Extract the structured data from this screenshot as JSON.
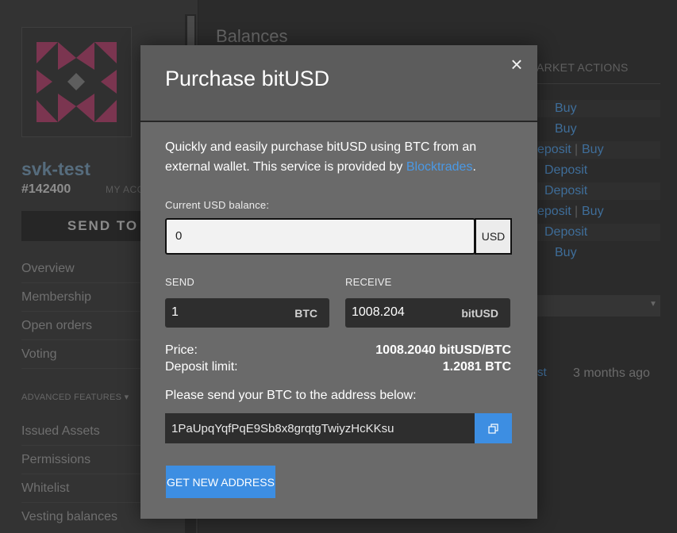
{
  "sidebar": {
    "account_name": "svk-test",
    "account_id": "#142400",
    "my_account_label": "MY ACC",
    "send_to_label": "SEND TO",
    "nav": [
      "Overview",
      "Membership",
      "Open orders",
      "Voting"
    ],
    "advanced_label": "ADVANCED FEATURES ▾",
    "advanced_nav": [
      "Issued Assets",
      "Permissions",
      "Whitelist",
      "Vesting balances"
    ]
  },
  "main": {
    "title": "Balances",
    "market_actions_header": "ARKET ACTIONS",
    "action_rows": [
      {
        "left": "",
        "right": "Buy"
      },
      {
        "left": "",
        "right": "Buy"
      },
      {
        "left": "eposit",
        "right": "Buy"
      },
      {
        "left": "",
        "right": "Deposit"
      },
      {
        "left": "",
        "right": "Deposit"
      },
      {
        "left": "eposit",
        "right": "Buy"
      },
      {
        "left": "",
        "right": "Deposit"
      },
      {
        "left": "",
        "right": "Buy"
      }
    ],
    "history_link": "st",
    "history_time": "3 months ago"
  },
  "modal": {
    "title": "Purchase bitUSD",
    "close_glyph": "×",
    "intro_text": "Quickly and easily purchase bitUSD using BTC from an external wallet. This service is provided by ",
    "intro_link": "Blocktrades",
    "intro_end": ".",
    "balance_label": "Current USD balance:",
    "balance_value": "0",
    "balance_unit": "USD",
    "send_label": "SEND",
    "send_value": "1",
    "send_currency": "BTC",
    "receive_label": "RECEIVE",
    "receive_value": "1008.204",
    "receive_currency": "bitUSD",
    "price_label": "Price:",
    "price_value": "1008.2040 bitUSD/BTC",
    "deposit_limit_label": "Deposit limit:",
    "deposit_limit_value": "1.2081 BTC",
    "address_prompt": "Please send your BTC to the address below:",
    "address": "1PaUpqYqfPqE9Sb8x8grqtgTwiyzHcKKsu",
    "new_address_button": "GET NEW ADDRESS"
  },
  "colors": {
    "accent": "#3d8ee2",
    "link": "#4a99e6",
    "modal_bg": "#6a6a6a",
    "modal_header": "#5c5c5c"
  },
  "icons": {
    "close": "close-icon",
    "copy": "copy-icon",
    "avatar": "identicon"
  }
}
